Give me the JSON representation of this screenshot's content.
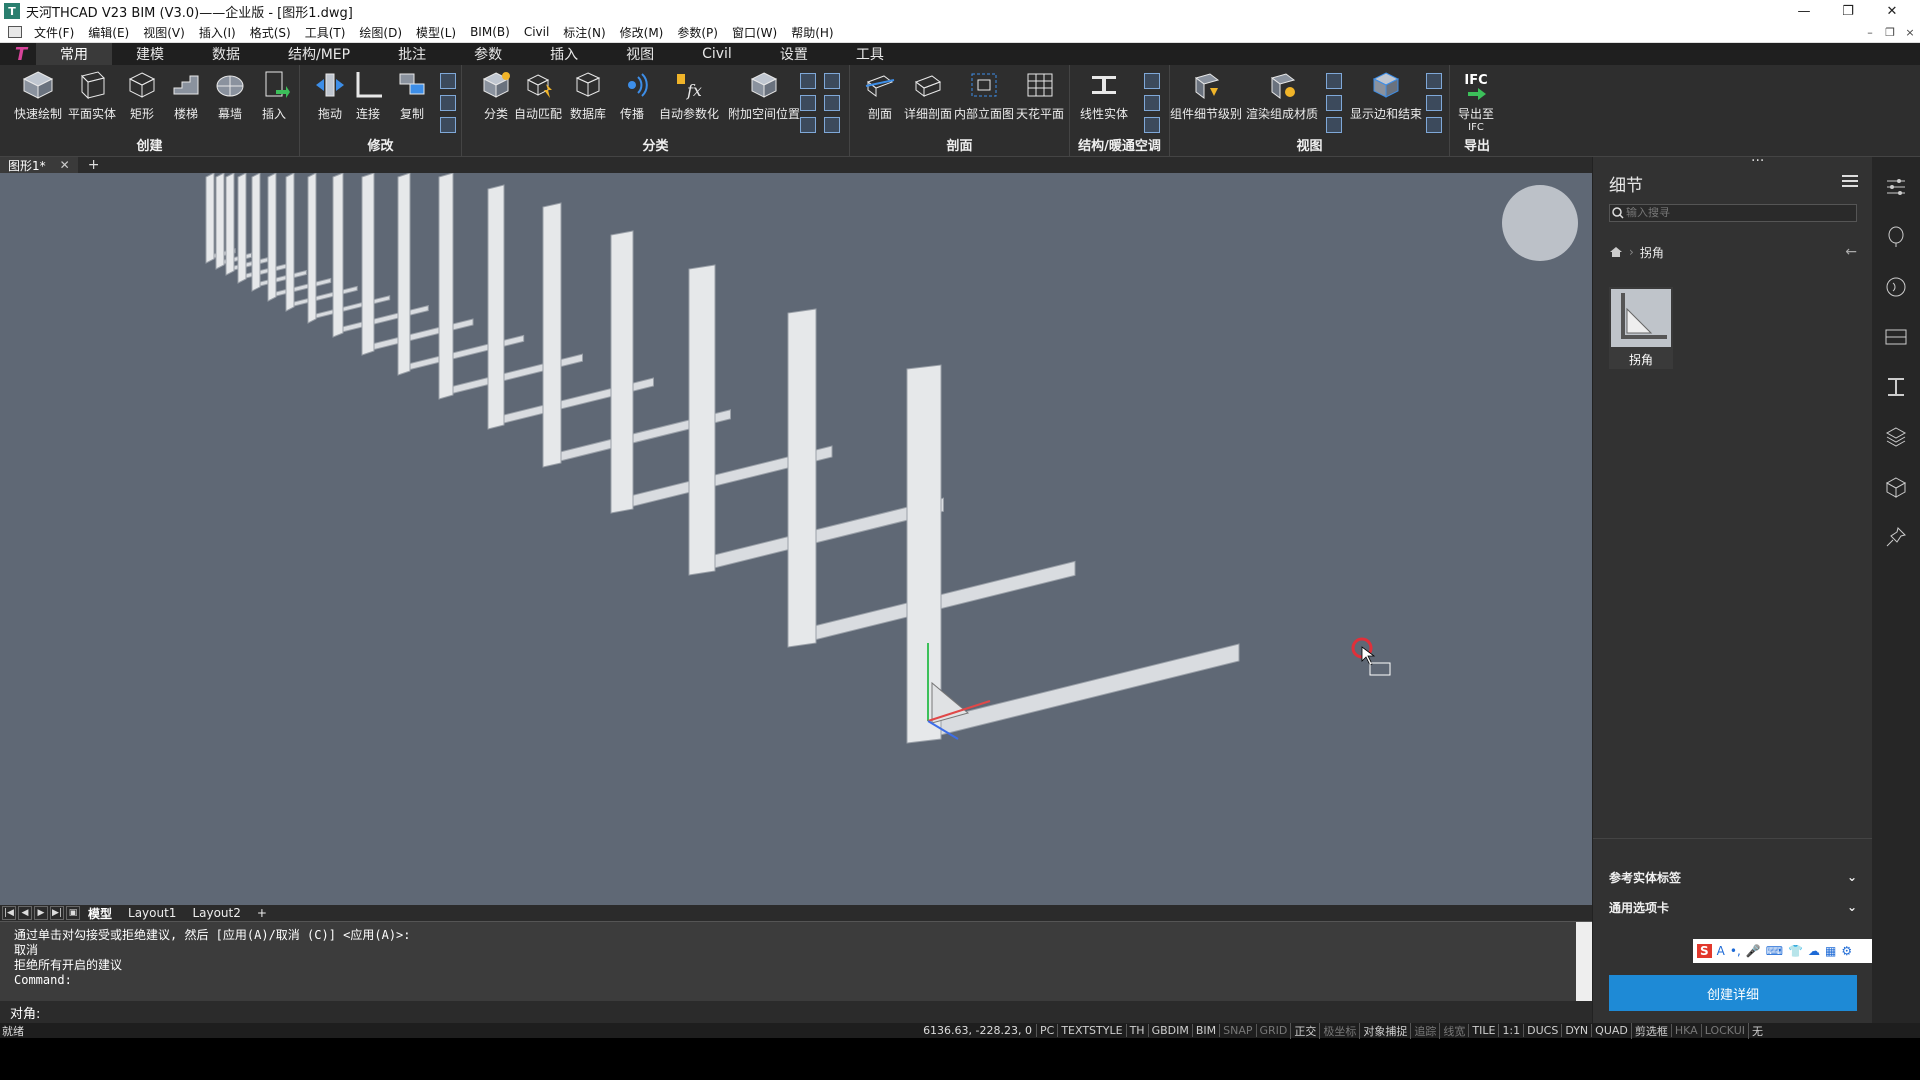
{
  "window": {
    "title": "天河THCAD V23 BIM (V3.0)——企业版 - [图形1.dwg]",
    "controls": [
      "—",
      "❐",
      "✕"
    ],
    "mdi_controls": [
      "–",
      "❐",
      "×"
    ]
  },
  "menubar": [
    "文件(F)",
    "编辑(E)",
    "视图(V)",
    "插入(I)",
    "格式(S)",
    "工具(T)",
    "绘图(D)",
    "模型(L)",
    "BIM(B)",
    "Civil",
    "标注(N)",
    "修改(M)",
    "参数(P)",
    "窗口(W)",
    "帮助(H)"
  ],
  "ribbon_tabs": [
    "常用",
    "建模",
    "数据",
    "结构/MEP",
    "批注",
    "参数",
    "插入",
    "视图",
    "Civil",
    "设置",
    "工具"
  ],
  "ribbon_groups": {
    "create": {
      "title": "创建",
      "buttons": [
        "快速绘制",
        "平面实体",
        "矩形",
        "楼梯",
        "幕墙",
        "插入"
      ]
    },
    "modify": {
      "title": "修改",
      "buttons": [
        "拖动",
        "连接",
        "复制"
      ]
    },
    "classify": {
      "title": "分类",
      "buttons": [
        "分类",
        "自动匹配",
        "数据库",
        "传播",
        "自动参数化",
        "附加空间位置"
      ]
    },
    "section": {
      "title": "剖面",
      "buttons": [
        "剖面",
        "详细剖面",
        "内部立面图",
        "天花平面"
      ]
    },
    "structure": {
      "title": "结构/暖通空调",
      "buttons": [
        "线性实体"
      ]
    },
    "view": {
      "title": "视图",
      "buttons": [
        "组件细节级别",
        "渲染组成材质",
        "显示边和结束"
      ]
    },
    "export": {
      "title": "导出",
      "ifc": "IFC",
      "buttons": [
        "导出至",
        "IFC"
      ]
    }
  },
  "doc_tabs": {
    "active": "图形1*",
    "close": "✕",
    "add": "+"
  },
  "layout_tabs": {
    "nav": [
      "|◀",
      "◀",
      "▶",
      "▶|",
      "▣"
    ],
    "tabs": [
      "模型",
      "Layout1",
      "Layout2"
    ],
    "add": "+"
  },
  "command_history": [
    "通过单击对勾接受或拒绝建议, 然后 [应用(A)/取消 (C)] <应用(A)>:",
    "取消",
    "拒绝所有开启的建议",
    "Command:"
  ],
  "command_prompt": "对角:",
  "status": {
    "ready": "就绪",
    "coords": "6136.63, -228.23, 0",
    "items": [
      "PC",
      "TEXTSTYLE",
      "TH",
      "GBDIM",
      "BIM",
      "SNAP",
      "GRID",
      "正交",
      "极坐标",
      "对象捕捉",
      "追踪",
      "线宽",
      "TILE",
      "1:1",
      "DUCS",
      "DYN",
      "QUAD",
      "剪选框",
      "HKA",
      "LOCKUI",
      "无"
    ],
    "off_items": [
      "SNAP",
      "GRID",
      "极坐标",
      "追踪",
      "线宽",
      "HKA",
      "LOCKUI"
    ]
  },
  "detail_panel": {
    "title": "细节",
    "ellipsis": "...",
    "search_placeholder": "输入搜寻",
    "breadcrumb": "拐角",
    "thumb_label": "拐角",
    "sections": [
      "参考实体标签",
      "通用选项卡"
    ],
    "create_button": "创建详细"
  },
  "ime_bar": [
    "S",
    "A",
    "•,",
    "🎤",
    "⌨",
    "👕",
    "☁",
    "▦",
    "⚙"
  ],
  "colors": {
    "viewport_bg": "#5f6875",
    "accent_blue": "#1e8ad6",
    "ribbon_bg": "#2e2e2e",
    "panel_bg": "#323232"
  }
}
